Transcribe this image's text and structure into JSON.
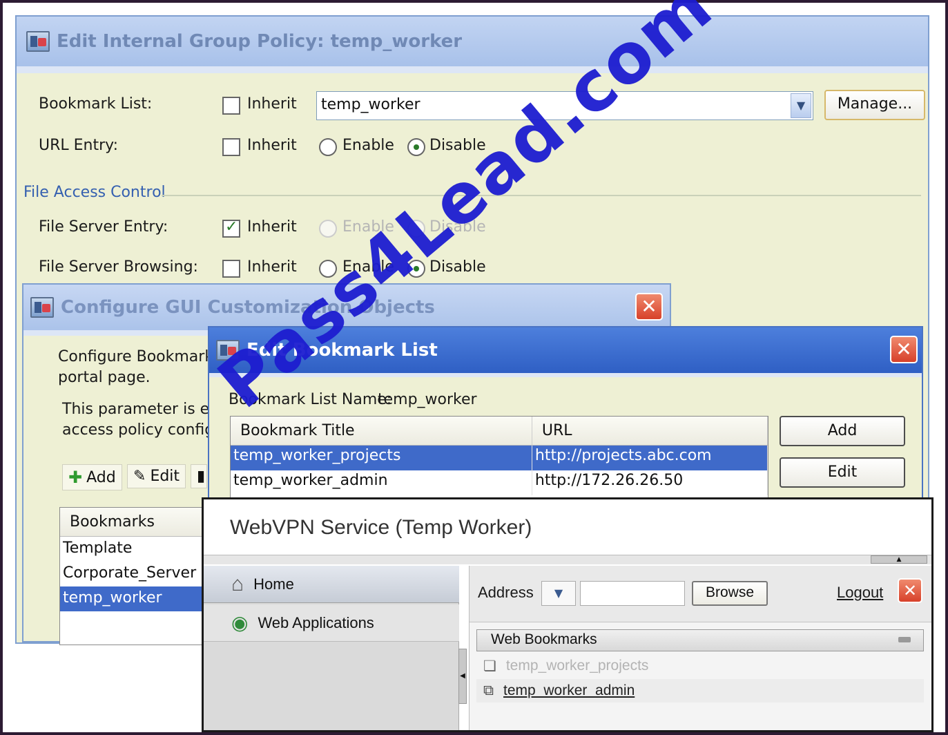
{
  "group_policy": {
    "title": "Edit Internal Group Policy: temp_worker",
    "bookmark_list_label": "Bookmark List:",
    "bookmark_inherit_label": "Inherit",
    "bookmark_value": "temp_worker",
    "manage_label": "Manage...",
    "url_entry_label": "URL Entry:",
    "url_inherit_label": "Inherit",
    "url_enable_label": "Enable",
    "url_disable_label": "Disable",
    "file_access_legend": "File Access Control",
    "file_server_entry_label": "File Server Entry:",
    "fse_inherit_label": "Inherit",
    "fse_enable_label": "Enable",
    "fse_disable_label": "Disable",
    "file_server_browsing_label": "File Server Browsing:",
    "fsb_inherit_label": "Inherit",
    "fsb_enable_label": "Enable",
    "fsb_disable_label": "Disable"
  },
  "gui_custom": {
    "title": "Configure GUI Customization Objects",
    "desc1a": "Configure Bookmark L",
    "desc1b": "portal page.",
    "desc2a": "This parameter is enf",
    "desc2b": "access policy configu",
    "add_label": "Add",
    "edit_label": "Edit",
    "table_header": "Bookmarks",
    "rows": [
      "Template",
      "Corporate_Server",
      "temp_worker"
    ]
  },
  "bookmark_list": {
    "title": "Edit Bookmark List",
    "name_label": "Bookmark List Name:",
    "name_value": "temp_worker",
    "col_title": "Bookmark Title",
    "col_url": "URL",
    "rows": [
      {
        "title": "temp_worker_projects",
        "url": "http://projects.abc.com"
      },
      {
        "title": "temp_worker_admin",
        "url": "http://172.26.26.50"
      }
    ],
    "add_label": "Add",
    "edit_label": "Edit"
  },
  "webvpn": {
    "title": "WebVPN Service (Temp Worker)",
    "nav": [
      "Home",
      "Web Applications"
    ],
    "address_label": "Address",
    "browse_label": "Browse",
    "logout_label": "Logout",
    "web_bookmarks_label": "Web Bookmarks",
    "bookmarks": [
      "temp_worker_projects",
      "temp_worker_admin"
    ]
  },
  "watermark": "Pass4Lead.com",
  "colors": {
    "selection": "#3f6ac9",
    "panel": "#eef0d4",
    "title_active": "#2f5fc4",
    "close": "#d7412a"
  }
}
